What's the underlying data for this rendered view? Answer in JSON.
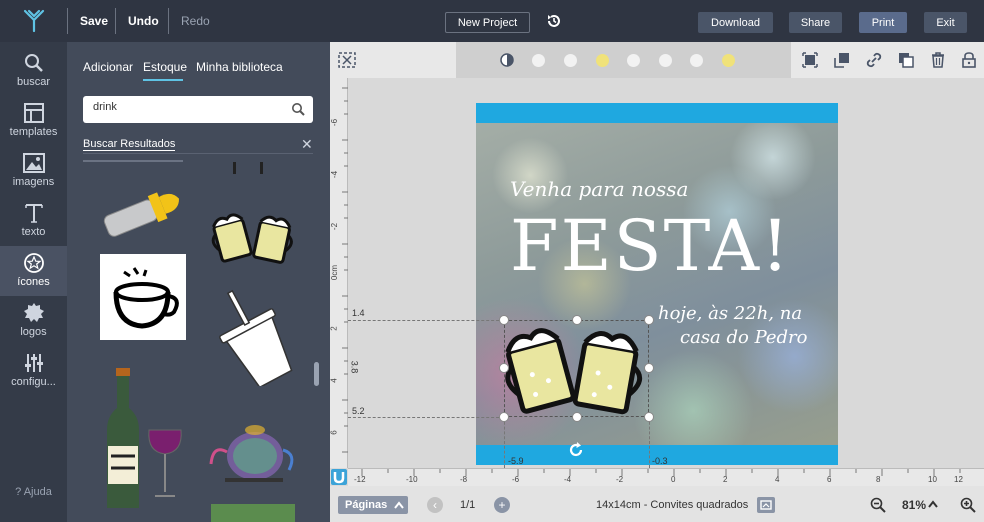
{
  "topbar": {
    "save": "Save",
    "undo": "Undo",
    "redo": "Redo",
    "new_project": "New Project",
    "download": "Download",
    "share": "Share",
    "print": "Print",
    "exit": "Exit"
  },
  "iconbar": {
    "items": [
      {
        "label": "buscar",
        "icon": "search-icon"
      },
      {
        "label": "templates",
        "icon": "template-icon"
      },
      {
        "label": "imagens",
        "icon": "image-icon"
      },
      {
        "label": "texto",
        "icon": "text-icon"
      },
      {
        "label": "ícones",
        "icon": "star-icon"
      },
      {
        "label": "logos",
        "icon": "logo-icon"
      },
      {
        "label": "configu...",
        "icon": "sliders-icon"
      }
    ],
    "active_index": 4,
    "help": "? Ajuda"
  },
  "panel": {
    "tabs": [
      "Adicionar",
      "Estoque",
      "Minha biblioteca"
    ],
    "active_tab": "Estoque",
    "search_value": "drink",
    "results_label": "Buscar Resultados",
    "results": [
      {
        "icon": "baby-bottle-icon"
      },
      {
        "icon": "beer-mugs-icon"
      },
      {
        "icon": "coffee-cup-icon"
      },
      {
        "icon": "soda-cup-icon"
      },
      {
        "icon": "wine-bottle-icon"
      },
      {
        "icon": "teapot-icon"
      }
    ]
  },
  "canvas": {
    "text_venha": "Venha para nossa",
    "text_festa": "FESTA!",
    "text_hoje": "hoje, às 22h, na",
    "text_casa": "casa do Pedro",
    "dim_top": "1.4",
    "dim_bottom": "5.2",
    "dim_height": "3.8",
    "dim_left": "-5.9",
    "dim_right": "-0.3",
    "colors": {
      "banner": "#1fa8e0",
      "text": "#ffffff"
    }
  },
  "ruler": {
    "bottom_ticks": [
      "-12",
      "-10",
      "-8",
      "-6",
      "-4",
      "-2",
      "0",
      "2",
      "4",
      "6",
      "8",
      "10",
      "12"
    ],
    "left_ticks": [
      "-6",
      "-4",
      "-2",
      "0cm",
      "2",
      "4",
      "6"
    ]
  },
  "bottombar": {
    "pages": "Páginas",
    "page_num": "1/1",
    "doc_size": "14x14cm - Convites quadrados",
    "zoom": "81%"
  }
}
